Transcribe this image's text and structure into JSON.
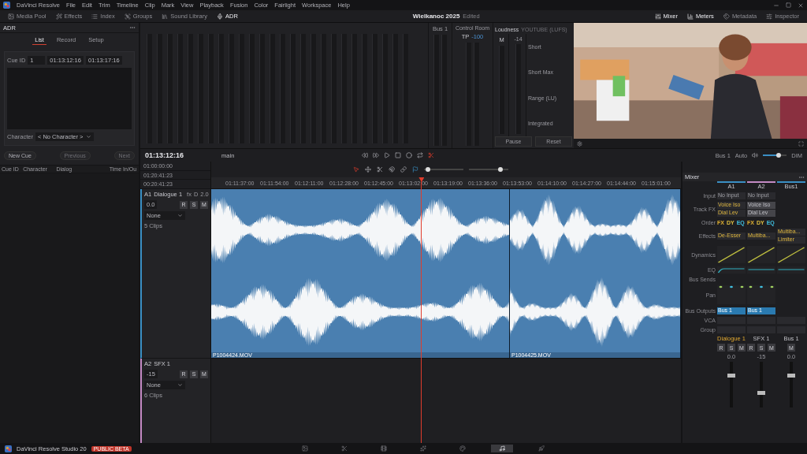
{
  "menu_bar": {
    "app_name": "DaVinci Resolve",
    "items": [
      "File",
      "Edit",
      "Trim",
      "Timeline",
      "Clip",
      "Mark",
      "View",
      "Playback",
      "Fusion",
      "Color",
      "Fairlight",
      "Workspace",
      "Help"
    ]
  },
  "toolbar": {
    "left": [
      {
        "label": "Media Pool",
        "selected": false
      },
      {
        "label": "Effects",
        "selected": false
      },
      {
        "label": "Index",
        "selected": false
      },
      {
        "label": "Groups",
        "selected": false
      },
      {
        "label": "Sound Library",
        "selected": false
      },
      {
        "label": "ADR",
        "selected": true
      }
    ],
    "project_title": "Wielkanoc 2025",
    "project_status": "Edited",
    "right": [
      {
        "label": "Mixer",
        "selected": true
      },
      {
        "label": "Meters",
        "selected": true
      },
      {
        "label": "Metadata",
        "selected": false
      },
      {
        "label": "Inspector",
        "selected": false
      }
    ]
  },
  "adr_panel": {
    "title": "ADR",
    "tabs": [
      {
        "label": "List",
        "selected": true
      },
      {
        "label": "Record",
        "selected": false
      },
      {
        "label": "Setup",
        "selected": false
      }
    ],
    "cue_id_label": "Cue ID",
    "cue_id": "1",
    "time_in": "01:13:12:16",
    "time_out": "01:13:17:16",
    "character_label": "Character",
    "character": "< No Character >",
    "buttons": [
      {
        "label": "New Cue",
        "disabled": false
      },
      {
        "label": "Previous",
        "disabled": true
      },
      {
        "label": "Next",
        "disabled": true
      }
    ],
    "columns": [
      "Cue ID",
      "Character",
      "Dialog",
      "Time In/Ou"
    ]
  },
  "meters": {
    "bus_label": "Bus 1",
    "control_room": {
      "title": "Control Room",
      "mode": "TP",
      "reading": "-100"
    },
    "loudness": {
      "title": "Loudness",
      "standard": "YOUTUBE (LUFS)",
      "mode": "M",
      "target": "-14",
      "stats": [
        "Short",
        "Short Max",
        "Range (LU)",
        "Integrated"
      ],
      "buttons": [
        "Pause",
        "Reset"
      ]
    }
  },
  "transport": {
    "timecode": "01:13:12:16",
    "timeline_name": "main",
    "output": "Bus 1",
    "automation": "Auto",
    "volume": {
      "level": 0.65
    },
    "dim": "DIM"
  },
  "zoom_sliders": [
    {
      "level": 0.1
    },
    {
      "level": 0.8
    }
  ],
  "timecodes": [
    "01:00:00:00",
    "01:20:41:23",
    "00:20:41:23"
  ],
  "ruler": [
    "01:11:37:00",
    "01:11:54:00",
    "01:12:11:00",
    "01:12:28:00",
    "01:12:45:00",
    "01:13:02:00",
    "01:13:19:00",
    "01:13:36:00",
    "01:13:53:00",
    "01:14:10:00",
    "01:14:27:00",
    "01:14:44:00",
    "01:15:01:00"
  ],
  "tracks": [
    {
      "id": "A1",
      "name": "Dialogue 1",
      "fx": "fx",
      "d": "D",
      "format": "2.0",
      "volume": "0.0",
      "buttons": [
        "R",
        "S",
        "M"
      ],
      "output": "None",
      "clip_count": "5 Clips",
      "selected": true,
      "clips": [
        "P1004424.MOV",
        "P1004425.MOV"
      ]
    },
    {
      "id": "A2",
      "name": "SFX 1",
      "volume": "-15",
      "buttons": [
        "R",
        "S",
        "M"
      ],
      "output": "None",
      "clip_count": "6 Clips",
      "selected": false
    }
  ],
  "mixer": {
    "title": "Mixer",
    "row_labels": [
      "Input",
      "Track FX",
      "Order",
      "Effects",
      "Dynamics",
      "EQ",
      "Bus Sends",
      "Pan",
      "Bus Outputs",
      "VCA",
      "Group"
    ],
    "channels": [
      {
        "name": "A1",
        "color": "#3a8fc4",
        "input": "No Input",
        "track_fx": [
          "Voice Iso",
          "Dial Lev"
        ],
        "fx_disabled": false,
        "order": [
          "FX",
          "DY",
          "EQ"
        ],
        "effects": [
          "De-Esser"
        ],
        "pan": true,
        "bus_output": "Bus 1",
        "strip_name": "Dialogue 1",
        "strip_selected": true,
        "buttons": [
          "R",
          "S",
          "M"
        ],
        "volume": "0.0",
        "level": 0.72
      },
      {
        "name": "A2",
        "color": "#c48ac4",
        "input": "No Input",
        "track_fx": [
          "Voice Iso",
          "Dial Lev"
        ],
        "fx_disabled": true,
        "order": [
          "FX",
          "DY",
          "EQ"
        ],
        "effects": [
          "Multiba..."
        ],
        "pan": true,
        "bus_output": "Bus 1",
        "strip_name": "SFX 1",
        "strip_selected": false,
        "buttons": [
          "R",
          "S",
          "M"
        ],
        "volume": "-15",
        "level": 0.3
      },
      {
        "name": "Bus1",
        "color": "#3a8fc4",
        "effects": [
          "Multiba...",
          "Limiter"
        ],
        "pan": false,
        "strip_name": "Bus 1",
        "strip_selected": false,
        "buttons": [
          "M"
        ],
        "volume": "0.0",
        "level": 0.72
      }
    ]
  },
  "status_bar": {
    "app": "DaVinci Resolve Studio 20",
    "badge": "PUBLIC BETA",
    "pages": [
      {
        "selected": false
      },
      {
        "selected": false
      },
      {
        "selected": false
      },
      {
        "selected": false
      },
      {
        "selected": false
      },
      {
        "selected": true
      },
      {
        "selected": false
      }
    ]
  }
}
